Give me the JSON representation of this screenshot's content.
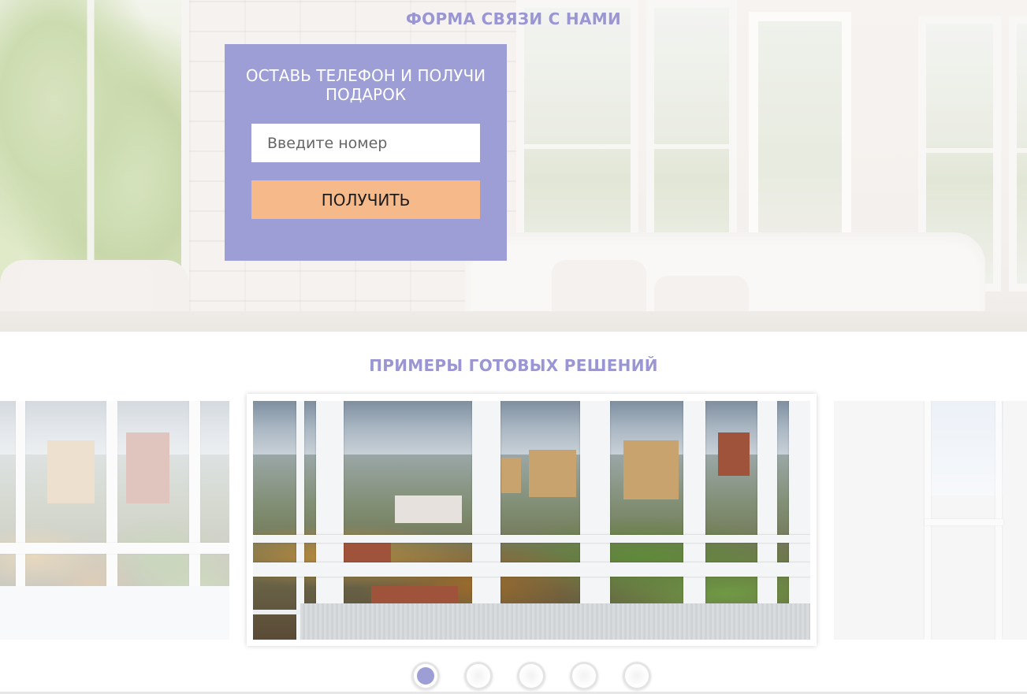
{
  "contact_section": {
    "title": "ФОРМА СВЯЗИ С НАМИ",
    "card_title": "ОСТАВЬ ТЕЛЕФОН И ПОЛУЧИ ПОДАРОК",
    "phone_placeholder": "Введите номер",
    "phone_value": "",
    "submit_label": "ПОЛУЧИТЬ"
  },
  "solutions_section": {
    "title": "ПРИМЕРЫ ГОТОВЫХ РЕШЕНИЙ",
    "slides": [
      {
        "position": "previous",
        "image": "balcony-windows-photo"
      },
      {
        "position": "current",
        "image": "balcony-windows-city-view-photo"
      },
      {
        "position": "next",
        "image": "balcony-interior-photo"
      }
    ],
    "pagination": {
      "total": 5,
      "active_index": 0
    }
  },
  "colors": {
    "accent": "#9d9ed6",
    "title": "#9a96d3",
    "button": "#f6b98a"
  }
}
